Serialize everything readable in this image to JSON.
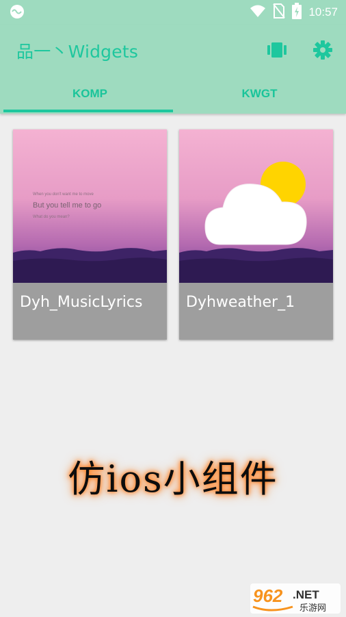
{
  "status_bar": {
    "time": "10:57",
    "icons": [
      "app-notification-icon",
      "wifi-icon",
      "no-sim-icon",
      "battery-charging-icon"
    ]
  },
  "app_bar": {
    "title": "品一丶Widgets",
    "actions": [
      "gallery-icon",
      "settings-gear-icon"
    ],
    "accent_color": "#1ec79e",
    "background_color": "#9edbbf"
  },
  "tabs": [
    {
      "label": "KOMP",
      "selected": true
    },
    {
      "label": "KWGT",
      "selected": false
    }
  ],
  "widgets": [
    {
      "name": "Dyh_MusicLyrics",
      "preview_lyrics": [
        "When you don't want me to move",
        "But you tell me to go",
        "What do you mean?"
      ]
    },
    {
      "name": "Dyhweather_1",
      "preview_icon": "cloud-sun-icon"
    }
  ],
  "promo_text": "仿ios小组件",
  "watermark": {
    "number": "962",
    "suffix": ".NET",
    "chinese": "乐游网"
  }
}
